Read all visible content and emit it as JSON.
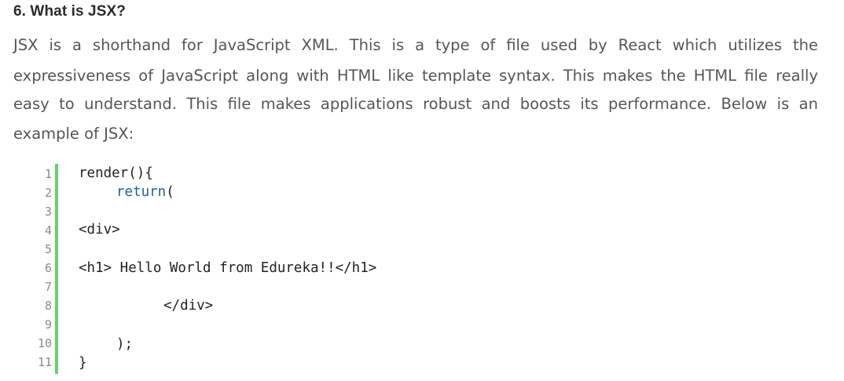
{
  "section": {
    "heading": "6. What is JSX?",
    "paragraph_lines": [
      "JSX is a shorthand for JavaScript XML. This is a type of file used by React which utilizes the",
      "expressiveness of JavaScript along with HTML like template syntax. This makes the HTML file really",
      "easy to understand. This file makes applications robust and boosts its performance. Below is an",
      "example of JSX:"
    ]
  },
  "code": {
    "line_numbers": [
      "1",
      "2",
      "3",
      "4",
      "5",
      "6",
      "7",
      "8",
      "9",
      "10",
      "11"
    ],
    "lines": {
      "l1": "render(){",
      "l2_kw": "return",
      "l2_rest": "(",
      "l4": "<div>",
      "l6": "<h1> Hello World from Edureka!!</h1>",
      "l8": "</div>",
      "l10": ");",
      "l11": "}"
    },
    "colors": {
      "gutter_bar": "#6ccf6f",
      "keyword": "#1a62a0"
    }
  }
}
